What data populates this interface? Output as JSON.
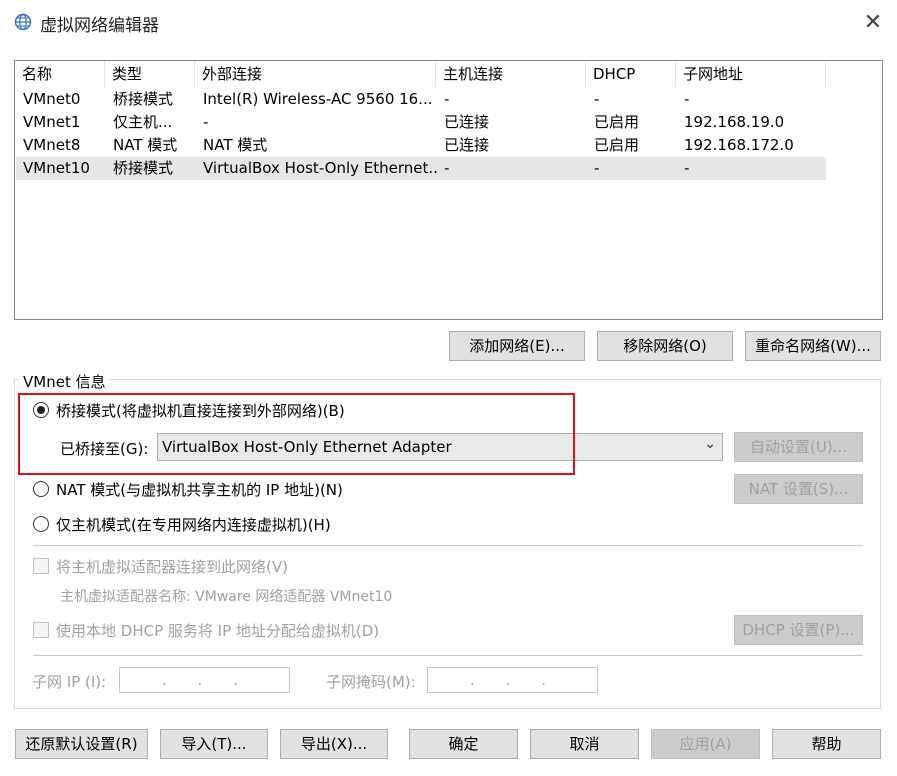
{
  "window": {
    "title": "虚拟网络编辑器",
    "icon": "globe-icon",
    "close_icon": "close-icon",
    "close_glyph": "✕"
  },
  "network_list": {
    "columns": [
      "名称",
      "类型",
      "外部连接",
      "主机连接",
      "DHCP",
      "子网地址"
    ],
    "rows": [
      [
        "VMnet0",
        "桥接模式",
        "Intel(R) Wireless-AC 9560 16...",
        "-",
        "-",
        "-"
      ],
      [
        "VMnet1",
        "仅主机...",
        "-",
        "已连接",
        "已启用",
        "192.168.19.0"
      ],
      [
        "VMnet8",
        "NAT 模式",
        "NAT 模式",
        "已连接",
        "已启用",
        "192.168.172.0"
      ],
      [
        "VMnet10",
        "桥接模式",
        "VirtualBox Host-Only Ethernet...",
        "-",
        "-",
        "-"
      ]
    ],
    "selected_row": 3
  },
  "list_buttons": {
    "add": "添加网络(E)...",
    "remove": "移除网络(O)",
    "rename": "重命名网络(W)..."
  },
  "vmnet_info": {
    "group_title": "VMnet 信息",
    "bridged_label": "桥接模式(将虚拟机直接连接到外部网络)(B)",
    "bridged_to_label": "已桥接至(G):",
    "bridged_to_value": "VirtualBox Host-Only Ethernet Adapter",
    "chevron": "⌄",
    "auto_settings": "自动设置(U)...",
    "nat_label": "NAT 模式(与虚拟机共享主机的 IP 地址)(N)",
    "nat_settings": "NAT 设置(S)...",
    "hostonly_label": "仅主机模式(在专用网络内连接虚拟机)(H)",
    "connect_adapter_label": "将主机虚拟适配器连接到此网络(V)",
    "adapter_name_label": "主机虚拟适配器名称: VMware 网络适配器 VMnet10",
    "dhcp_label": "使用本地 DHCP 服务将 IP 地址分配给虚拟机(D)",
    "dhcp_settings": "DHCP 设置(P)...",
    "subnet_ip_label": "子网 IP (I):",
    "subnet_mask_label": "子网掩码(M):",
    "ip_dots": ".   .   .",
    "selected_mode": "bridged"
  },
  "footer_buttons": {
    "restore": "还原默认设置(R)",
    "import": "导入(T)...",
    "export": "导出(X)...",
    "ok": "确定",
    "cancel": "取消",
    "apply": "应用(A)",
    "help": "帮助"
  },
  "colors": {
    "highlight_box": "#e0101b",
    "selected_row": "#e6e6e6",
    "button": "#e1e1e1"
  }
}
